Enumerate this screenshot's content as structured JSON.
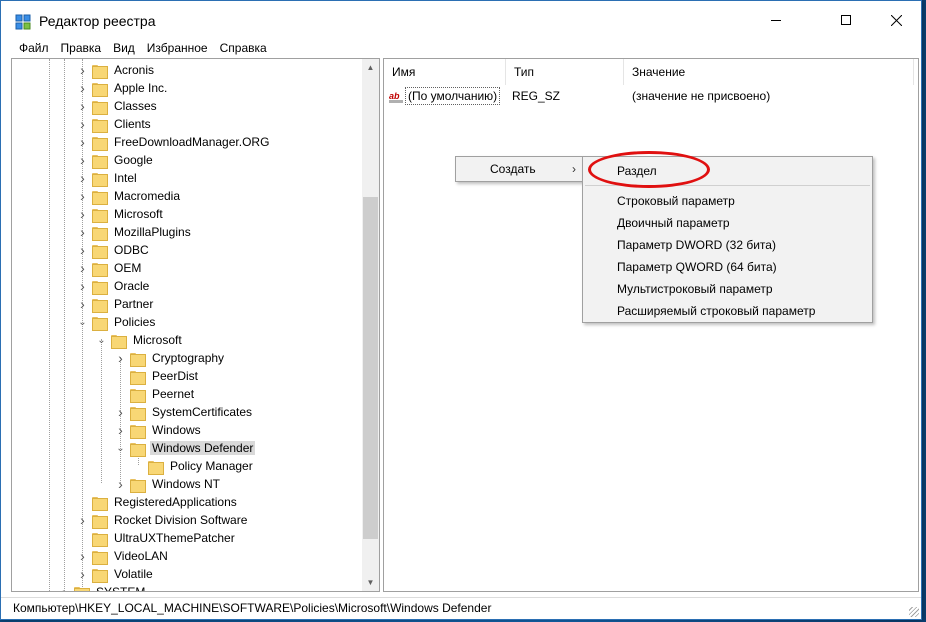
{
  "window": {
    "title": "Редактор реестра",
    "icon": "registry-editor-icon",
    "controls": {
      "minimize": "minimize-icon",
      "maximize": "maximize-icon",
      "close": "close-icon"
    }
  },
  "menu": [
    "Файл",
    "Правка",
    "Вид",
    "Избранное",
    "Справка"
  ],
  "tree": {
    "items": [
      {
        "label": "Acronis",
        "expander": ">"
      },
      {
        "label": "Apple Inc.",
        "expander": ">"
      },
      {
        "label": "Classes",
        "expander": ">"
      },
      {
        "label": "Clients",
        "expander": ">"
      },
      {
        "label": "FreeDownloadManager.ORG",
        "expander": ">"
      },
      {
        "label": "Google",
        "expander": ">"
      },
      {
        "label": "Intel",
        "expander": ">"
      },
      {
        "label": "Macromedia",
        "expander": ">"
      },
      {
        "label": "Microsoft",
        "expander": ">"
      },
      {
        "label": "MozillaPlugins",
        "expander": ">"
      },
      {
        "label": "ODBC",
        "expander": ">"
      },
      {
        "label": "OEM",
        "expander": ">"
      },
      {
        "label": "Oracle",
        "expander": ">"
      },
      {
        "label": "Partner",
        "expander": ">"
      },
      {
        "label": "Policies",
        "expander": "v"
      },
      {
        "label": "Microsoft",
        "expander": "v"
      },
      {
        "label": "Cryptography",
        "expander": ">"
      },
      {
        "label": "PeerDist",
        "expander": ""
      },
      {
        "label": "Peernet",
        "expander": ""
      },
      {
        "label": "SystemCertificates",
        "expander": ">"
      },
      {
        "label": "Windows",
        "expander": ">"
      },
      {
        "label": "Windows Defender",
        "expander": "v",
        "selected": true
      },
      {
        "label": "Policy Manager",
        "expander": ""
      },
      {
        "label": "Windows NT",
        "expander": ">"
      },
      {
        "label": "RegisteredApplications",
        "expander": ""
      },
      {
        "label": "Rocket Division Software",
        "expander": ">"
      },
      {
        "label": "UltraUXThemePatcher",
        "expander": ""
      },
      {
        "label": "VideoLAN",
        "expander": ">"
      },
      {
        "label": "Volatile",
        "expander": ">"
      },
      {
        "label": "SYSTEM",
        "expander": ">"
      }
    ]
  },
  "list": {
    "columns": [
      "Имя",
      "Тип",
      "Значение"
    ],
    "rows": [
      {
        "icon": "string-value-icon",
        "icon_text": "ab",
        "name": "(По умолчанию)",
        "type": "REG_SZ",
        "value": "(значение не присвоено)"
      }
    ]
  },
  "context_menu": {
    "item": "Создать",
    "submenu": [
      "Раздел",
      "Строковый параметр",
      "Двоичный параметр",
      "Параметр DWORD (32 бита)",
      "Параметр QWORD (64 бита)",
      "Мультистроковый параметр",
      "Расширяемый строковый параметр"
    ]
  },
  "status_bar": "Компьютер\\HKEY_LOCAL_MACHINE\\SOFTWARE\\Policies\\Microsoft\\Windows Defender",
  "colors": {
    "highlight_oval": "#e01010",
    "selected_bg": "#d9d9d9",
    "folder": "#f8d775"
  }
}
